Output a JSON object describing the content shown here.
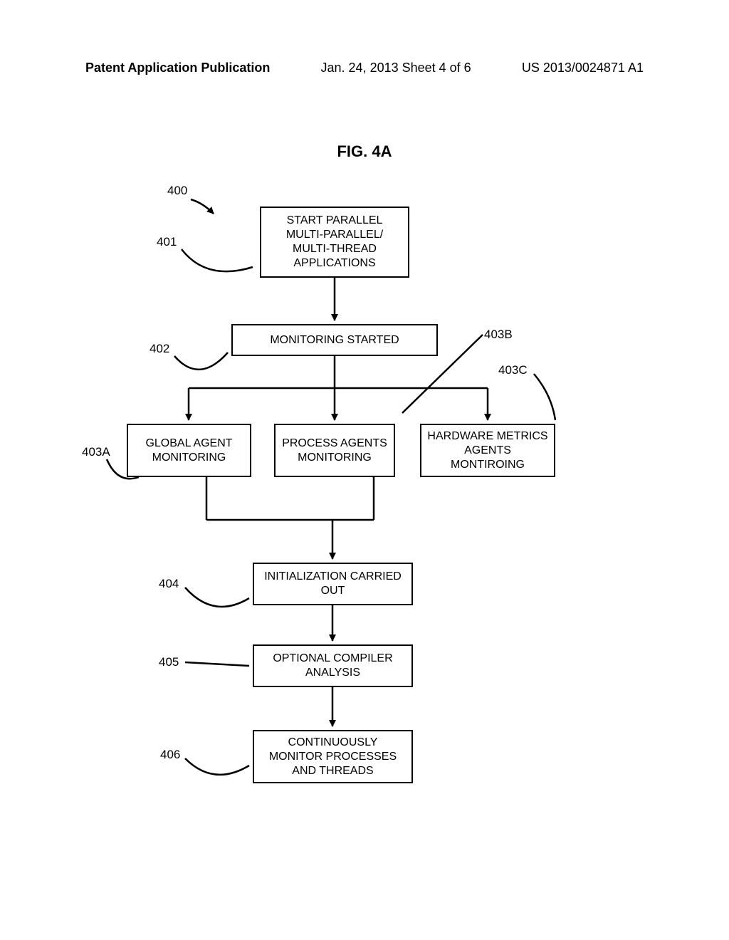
{
  "header": {
    "left": "Patent Application Publication",
    "mid": "Jan. 24, 2013  Sheet 4 of 6",
    "right": "US 2013/0024871 A1"
  },
  "figure_title": "FIG. 4A",
  "labels": {
    "l400": "400",
    "l401": "401",
    "l402": "402",
    "l403A": "403A",
    "l403B": "403B",
    "l403C": "403C",
    "l404": "404",
    "l405": "405",
    "l406": "406"
  },
  "boxes": {
    "b401": "START PARALLEL MULTI-PARALLEL/ MULTI-THREAD APPLICATIONS",
    "b402": "MONITORING STARTED",
    "b403A": "GLOBAL AGENT MONITORING",
    "b403B": "PROCESS AGENTS MONITORING",
    "b403C": "HARDWARE METRICS AGENTS MONTIROING",
    "b404": "INITIALIZATION CARRIED OUT",
    "b405": "OPTIONAL COMPILER ANALYSIS",
    "b406": "CONTINUOUSLY MONITOR PROCESSES AND THREADS"
  }
}
